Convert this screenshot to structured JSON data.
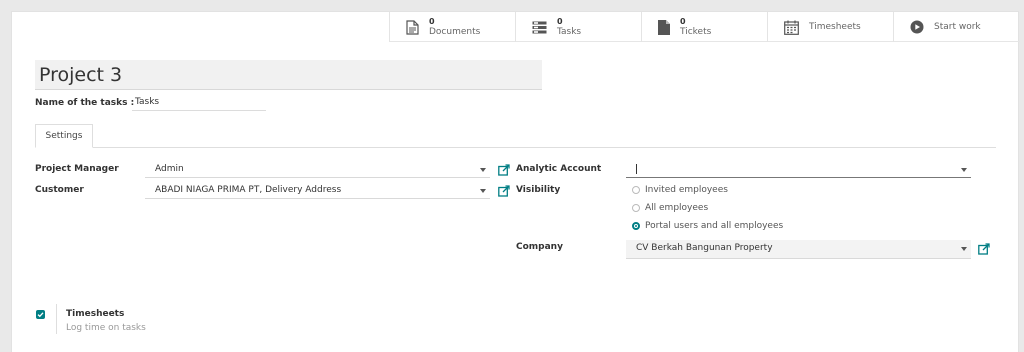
{
  "smart_buttons": [
    {
      "count": "0",
      "label": "Documents",
      "icon": "document-icon"
    },
    {
      "count": "0",
      "label": "Tasks",
      "icon": "tasks-icon"
    },
    {
      "count": "0",
      "label": "Tickets",
      "icon": "ticket-icon"
    },
    {
      "count": "",
      "label": "Timesheets",
      "icon": "calendar-icon"
    },
    {
      "count": "",
      "label": "Start work",
      "icon": "play-icon"
    }
  ],
  "project": {
    "name": "Project 3",
    "tasks_label": "Name of the tasks :",
    "tasks_value": "Tasks"
  },
  "tabs": [
    {
      "label": "Settings",
      "active": true
    }
  ],
  "fields": {
    "project_manager": {
      "label": "Project Manager",
      "value": "Admin"
    },
    "customer": {
      "label": "Customer",
      "value": "ABADI NIAGA PRIMA PT, Delivery Address"
    },
    "analytic_account": {
      "label": "Analytic Account",
      "value": ""
    },
    "visibility": {
      "label": "Visibility",
      "options": [
        "Invited employees",
        "All employees",
        "Portal users and all employees"
      ],
      "selected": "Portal users and all employees"
    },
    "company": {
      "label": "Company",
      "value": "CV Berkah Bangunan Property"
    }
  },
  "timesheets": {
    "title": "Timesheets",
    "description": "Log time on tasks",
    "checked": true
  },
  "colors": {
    "accent": "#017e84",
    "background": "#e9e9e9"
  }
}
